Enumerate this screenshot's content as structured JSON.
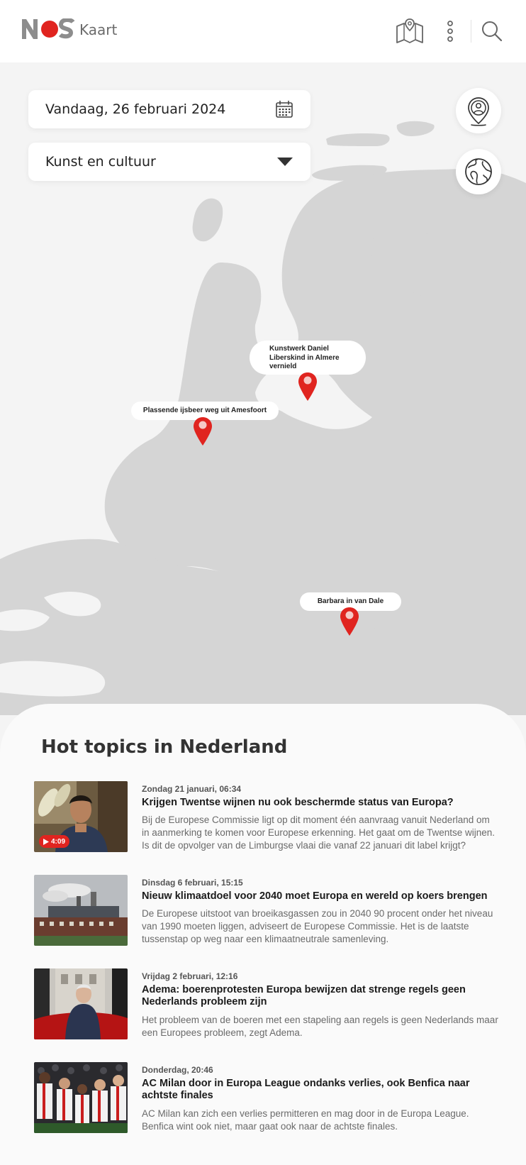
{
  "header": {
    "logo_text": "NOS",
    "logo_sub": "Kaart",
    "icons": [
      "map-icon",
      "more-vertical-icon",
      "search-icon"
    ]
  },
  "filters": {
    "date_label": "Vandaag, 26 februari 2024",
    "category_label": "Kunst en cultuur"
  },
  "map": {
    "markers": [
      {
        "label": "Kunstwerk Daniel Liberskind in Almere vernield"
      },
      {
        "label": "Plassende ijsbeer weg uit Amesfoort"
      },
      {
        "label": "Barbara in van Dale"
      }
    ],
    "side_buttons": [
      "location-person-icon",
      "globe-icon"
    ]
  },
  "hot_topics": {
    "title": "Hot topics in Nederland",
    "articles": [
      {
        "date": "Zondag 21 januari, 06:34",
        "title": "Krijgen Twentse wijnen nu ook beschermde status van Europa?",
        "description": "Bij de Europese Commissie ligt op dit moment één aanvraag vanuit Nederland om in aanmerking te komen voor Europese erkenning. Het gaat om de Twentse wijnen. Is dit de opvolger van de Limburgse vlaai die vanaf 22 januari dit label krijgt?",
        "video_duration": "4:09"
      },
      {
        "date": "Dinsdag 6 februari, 15:15",
        "title": "Nieuw klimaatdoel voor 2040 moet Europa en wereld op koers brengen",
        "description": "De Europese uitstoot van broeikasgassen zou in 2040 90 procent onder het niveau van 1990 moeten liggen, adviseert de Europese Commissie. Het is de laatste tussenstap op weg naar een klimaatneutrale samenleving."
      },
      {
        "date": "Vrijdag 2 februari, 12:16",
        "title": "Adema: boerenprotesten Europa bewijzen dat strenge regels geen Nederlands probleem zijn",
        "description": "Het probleem van de boeren met een stapeling aan regels is geen Nederlands maar een Europees probleem, zegt Adema."
      },
      {
        "date": "Donderdag, 20:46",
        "title": "AC Milan door in Europa League ondanks verlies, ook Benfica naar achtste finales",
        "description": "AC Milan kan zich een verlies permitteren en mag door in de Europa League. Benfica wint ook niet, maar gaat ook naar de achtste finales."
      }
    ]
  },
  "colors": {
    "brand_red": "#e0241f",
    "land_gray": "#d5d5d5",
    "background": "#f4f4f4"
  }
}
